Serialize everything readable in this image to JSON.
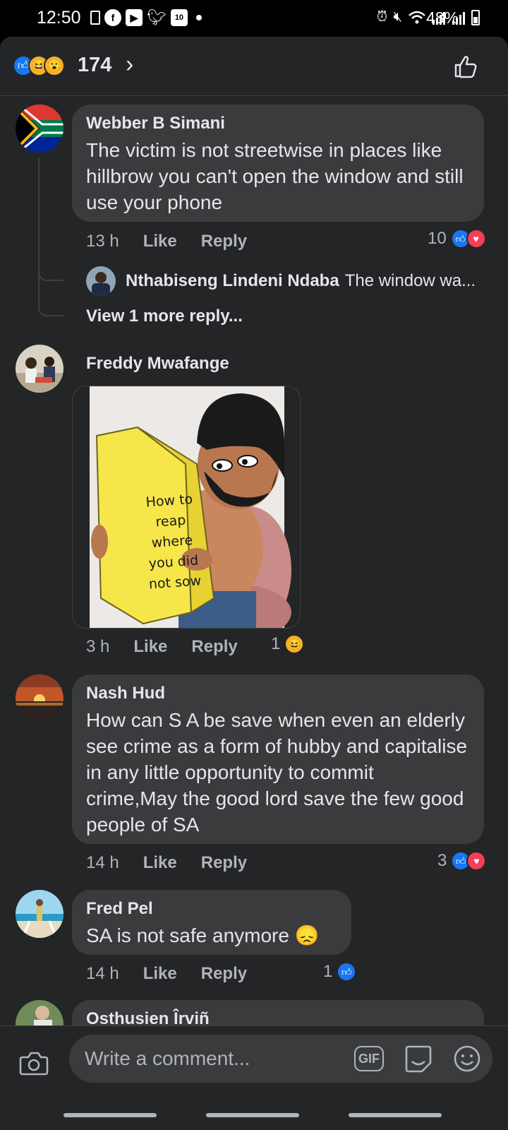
{
  "status_bar": {
    "time": "12:50",
    "battery": "48%",
    "left_icons": [
      "sim-icon",
      "facebook-icon",
      "youtube-icon",
      "twitter-icon",
      "notification-10-icon"
    ],
    "notif_badge": "10",
    "right_icons": [
      "alarm-icon",
      "mute-icon",
      "wifi-icon",
      "signal-icon",
      "signal-icon"
    ]
  },
  "reaction_header": {
    "count": "174",
    "icons": [
      "like",
      "haha",
      "wow"
    ]
  },
  "comments": [
    {
      "author": "Webber B Simani",
      "text": "The victim is not streetwise in places like hillbrow you can't open the window and still use your phone",
      "time": "13 h",
      "like": "Like",
      "reply": "Reply",
      "reactions": "10",
      "reply_preview": {
        "author": "Nthabiseng Lindeni Ndaba",
        "text": "The window wa..."
      },
      "view_more": "View 1 more reply..."
    },
    {
      "author": "Freddy Mwafange",
      "meme_text": [
        "How to",
        "reap",
        "where",
        "you did",
        "not sow"
      ],
      "time": "3 h",
      "like": "Like",
      "reply": "Reply",
      "reactions": "1"
    },
    {
      "author": "Nash Hud",
      "text": "How can S A be save when even an elderly see crime as  a form of hubby and capitalise in any little opportunity to commit crime,May the good lord save the few good people of SA",
      "time": "14 h",
      "like": "Like",
      "reply": "Reply",
      "reactions": "3"
    },
    {
      "author": "Fred Pel",
      "text": "SA is not safe anymore 😞",
      "time": "14 h",
      "like": "Like",
      "reply": "Reply",
      "reactions": "1"
    },
    {
      "author": "Osthusien Îrviñ"
    }
  ],
  "composer": {
    "placeholder": "Write a comment...",
    "gif_label": "GIF"
  }
}
